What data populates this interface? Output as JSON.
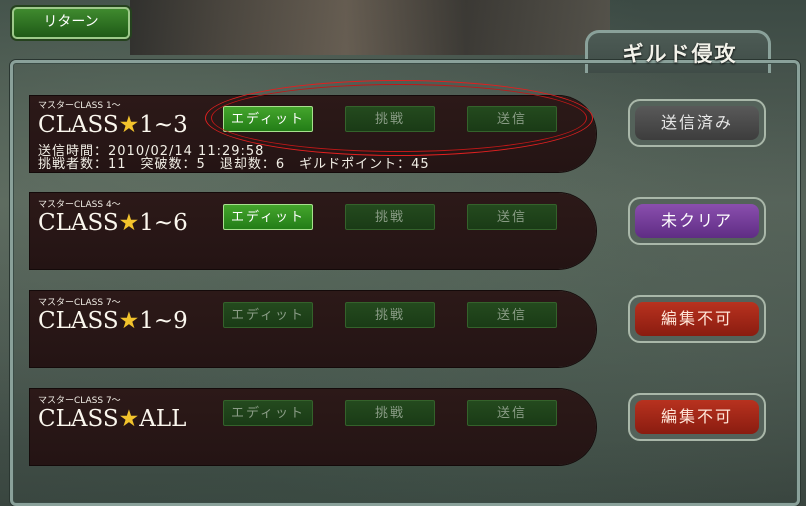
{
  "header": {
    "return_label": "リターン",
    "title": "ギルド侵攻"
  },
  "rows": [
    {
      "class_small": "マスターCLASS 1～",
      "class_prefix": "CLASS",
      "class_range": "1~3",
      "send_time": "送信時間：2010/02/14 11:29:58",
      "stats": "挑戦者数：11　突破数：5　退却数：6　ギルドポイント：45",
      "edit_label": "エディット",
      "challenge_label": "挑戦",
      "send_label": "送信",
      "edit_enabled": true,
      "status": "送信済み",
      "status_color": "#4a4a4a"
    },
    {
      "class_small": "マスターCLASS 4～",
      "class_prefix": "CLASS",
      "class_range": "1~6",
      "edit_label": "エディット",
      "challenge_label": "挑戦",
      "send_label": "送信",
      "edit_enabled": true,
      "status": "未クリア",
      "status_color": "#7a3f9e"
    },
    {
      "class_small": "マスターCLASS 7～",
      "class_prefix": "CLASS",
      "class_range": "1~9",
      "edit_label": "エディット",
      "challenge_label": "挑戦",
      "send_label": "送信",
      "edit_enabled": false,
      "status": "編集不可",
      "status_color": "#a82817"
    },
    {
      "class_small": "マスターCLASS 7～",
      "class_prefix": "CLASS",
      "class_range": "ALL",
      "edit_label": "エディット",
      "challenge_label": "挑戦",
      "send_label": "送信",
      "edit_enabled": false,
      "status": "編集不可",
      "status_color": "#a82817"
    }
  ],
  "icons": {
    "star": "star-icon"
  },
  "colors": {
    "accent_green": "#3a9a28",
    "star": "#f2c32c",
    "highlight_oval": "#e02020"
  }
}
